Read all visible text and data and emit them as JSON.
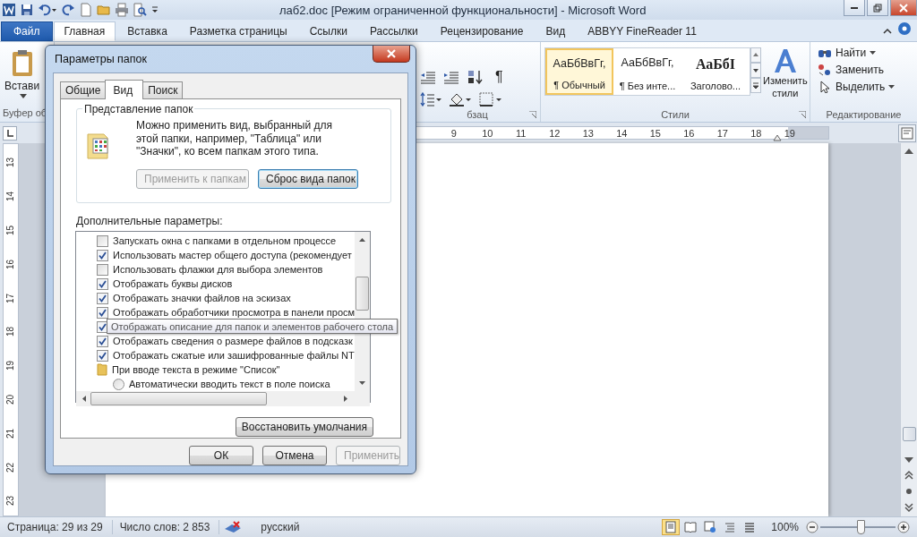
{
  "title_bar": {
    "title": "лаб2.doc [Режим ограниченной функциональности]  -  Microsoft Word"
  },
  "ribbon_tabs": [
    {
      "label": "Файл",
      "kind": "file",
      "selected": false
    },
    {
      "label": "Главная",
      "kind": "tab",
      "selected": true
    },
    {
      "label": "Вставка",
      "kind": "tab",
      "selected": false
    },
    {
      "label": "Разметка страницы",
      "kind": "tab",
      "selected": false
    },
    {
      "label": "Ссылки",
      "kind": "tab",
      "selected": false
    },
    {
      "label": "Рассылки",
      "kind": "tab",
      "selected": false
    },
    {
      "label": "Рецензирование",
      "kind": "tab",
      "selected": false
    },
    {
      "label": "Вид",
      "kind": "tab",
      "selected": false
    },
    {
      "label": "ABBYY FineReader 11",
      "kind": "tab",
      "selected": false
    }
  ],
  "ribbon": {
    "clipboard": {
      "button": "Встави",
      "group": "Буфер об"
    },
    "paragraph": {
      "pilcrow": "¶",
      "group": "бзац"
    },
    "styles": {
      "items": [
        {
          "preview": "АаБбВвГг,",
          "name": "¶ Обычный",
          "kind": "normal",
          "selected": true
        },
        {
          "preview": "АаБбВвГг,",
          "name": "¶ Без инте...",
          "kind": "normal",
          "selected": false
        },
        {
          "preview": "АаБбІ",
          "name": "Заголово...",
          "kind": "heading",
          "selected": false
        }
      ],
      "change_styles": "Изменить стили",
      "group": "Стили"
    },
    "editing": {
      "items": [
        {
          "label": "Найти",
          "kind": "find"
        },
        {
          "label": "Заменить",
          "kind": "replace"
        },
        {
          "label": "Выделить",
          "kind": "select"
        }
      ],
      "group": "Редактирование"
    }
  },
  "ruler": {
    "ticks": [
      "9",
      "10",
      "11",
      "12",
      "13",
      "14",
      "15",
      "16",
      "17",
      "18",
      "19"
    ]
  },
  "vertical_ruler": {
    "ticks": [
      "13",
      "14",
      "15",
      "16",
      "17",
      "18",
      "19",
      "20",
      "21",
      "22",
      "23"
    ]
  },
  "dialog": {
    "title": "Параметры папок",
    "tabs": [
      {
        "label": "Общие",
        "selected": false
      },
      {
        "label": "Вид",
        "selected": true
      },
      {
        "label": "Поиск",
        "selected": false
      }
    ],
    "folder_views": {
      "legend": "Представление папок",
      "description": "Можно применить вид, выбранный для этой папки, например, \"Таблица\" или \"Значки\", ко всем папкам этого типа.",
      "buttons": [
        {
          "label": "Применить к папкам",
          "disabled": true
        },
        {
          "label": "Сброс вида папок",
          "disabled": false
        }
      ]
    },
    "advanced_label": "Дополнительные параметры:",
    "settings": [
      {
        "kind": "checkbox",
        "checked": false,
        "label": "Запускать окна с папками в отдельном процессе"
      },
      {
        "kind": "checkbox",
        "checked": true,
        "label": "Использовать мастер общего доступа (рекомендует"
      },
      {
        "kind": "checkbox",
        "checked": false,
        "label": "Использовать флажки для выбора элементов"
      },
      {
        "kind": "checkbox",
        "checked": true,
        "label": "Отображать буквы дисков"
      },
      {
        "kind": "checkbox",
        "checked": true,
        "label": "Отображать значки файлов на эскизах"
      },
      {
        "kind": "checkbox",
        "checked": true,
        "label": "Отображать обработчики просмотра в панели просм"
      },
      {
        "kind": "checkbox",
        "checked": true
      },
      {
        "kind": "checkbox",
        "checked": true,
        "label": "Отображать сведения о размере файлов в подсказк"
      },
      {
        "kind": "checkbox",
        "checked": true,
        "label": "Отображать сжатые или зашифрованные файлы NT"
      },
      {
        "kind": "folder",
        "label": "При вводе текста в режиме \"Список\"",
        "children": [
          {
            "kind": "radio",
            "checked": false,
            "label": "Автоматически вводить текст в поле поиска"
          }
        ]
      }
    ],
    "tooltip": "Отображать описание для папок и элементов рабочего стола",
    "restore_button": "Восстановить умолчания",
    "buttons": [
      {
        "label": "ОК",
        "disabled": false
      },
      {
        "label": "Отмена",
        "disabled": false
      },
      {
        "label": "Применить",
        "disabled": true
      }
    ]
  },
  "status_bar": {
    "page": "Страница: 29 из 29",
    "words": "Число слов: 2 853",
    "language": "русский",
    "views": [
      {
        "kind": "print",
        "selected": true
      },
      {
        "kind": "reading",
        "selected": false
      },
      {
        "kind": "web",
        "selected": false
      },
      {
        "kind": "outline",
        "selected": false
      },
      {
        "kind": "draft",
        "selected": false
      }
    ],
    "zoom": "100%",
    "zoom_slider": {
      "level": 0.53
    }
  }
}
